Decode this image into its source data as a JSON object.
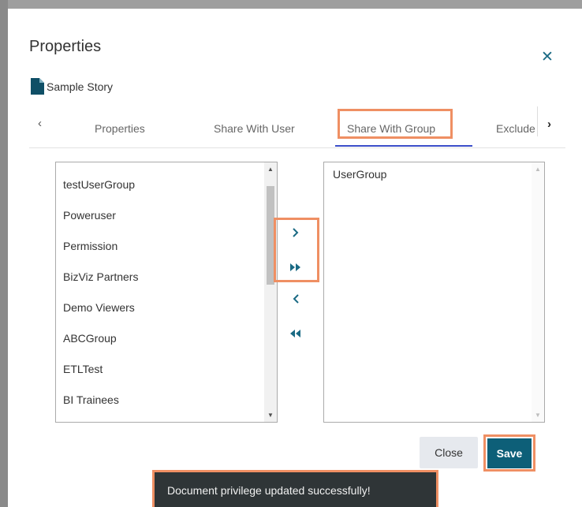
{
  "dialog": {
    "title": "Properties",
    "close_icon": "close-icon",
    "document": {
      "icon": "document-icon",
      "name": "Sample Story"
    }
  },
  "tabs": {
    "prev_icon": "chevron-left-icon",
    "next_icon": "chevron-right-icon",
    "items": [
      {
        "label": "Properties"
      },
      {
        "label": "Share With User"
      },
      {
        "label": "Share With Group",
        "active": true
      },
      {
        "label": "Exclude"
      }
    ]
  },
  "available_groups": {
    "items": [
      "testUserGroup",
      "Poweruser",
      "Permission",
      "BizViz Partners",
      "Demo Viewers",
      "ABCGroup",
      "ETLTest",
      "BI Trainees"
    ]
  },
  "selected_groups": {
    "items": [
      "UserGroup"
    ]
  },
  "move_buttons": {
    "move_right": "chevron-right-icon",
    "move_all_right": "double-triangle-right-icon",
    "move_left": "chevron-left-icon",
    "move_all_left": "double-triangle-left-icon"
  },
  "footer": {
    "close_label": "Close",
    "save_label": "Save"
  },
  "toast": {
    "message": "Document privilege updated successfully!"
  },
  "colors": {
    "accent": "#1a6a84",
    "save_bg": "#0d5f78",
    "highlight": "#ef8f63",
    "tab_underline": "#3b4ec9",
    "toast_bg": "#2f3537"
  }
}
